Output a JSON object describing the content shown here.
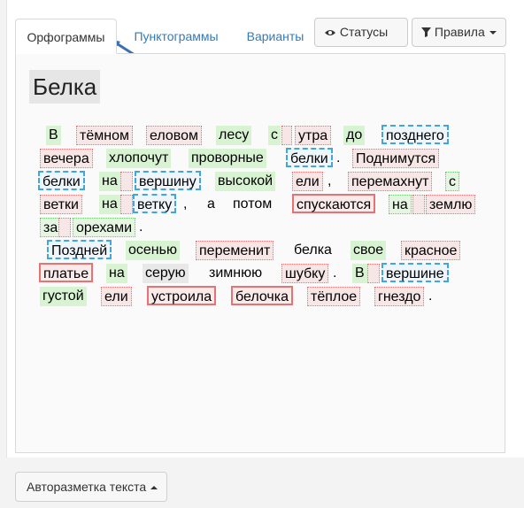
{
  "tabs": [
    {
      "label": "Орфограммы"
    },
    {
      "label": "Пунктограммы"
    },
    {
      "label": "Варианты"
    }
  ],
  "buttons": {
    "statuses": "Статусы",
    "rules": "Правила",
    "automark": "Авторазметка текста"
  },
  "icons": {
    "statuses": "eye-icon",
    "rules": "filter-icon",
    "caret": "caret-down-icon"
  },
  "title": "Белка",
  "colors": {
    "green": "#d8f3d2",
    "red": "#e57373",
    "blue": "#41a6e0",
    "link": "#337ab7"
  },
  "words": [
    "В",
    "тёмном",
    "еловом",
    "лесу",
    "с",
    "утра",
    "до",
    "позднего",
    "вечера",
    "хлопочут",
    "проворные",
    "белки",
    "Поднимутся",
    "белки",
    "на",
    "вершину",
    "высокой",
    "ели",
    "перемахнут",
    "с",
    "ветки",
    "на",
    "ветку",
    "а",
    "потом",
    "спускаются",
    "на",
    "землю",
    "за",
    "орехами",
    "Поздней",
    "осенью",
    "переменит",
    "белка",
    "свое",
    "красное",
    "платье",
    "на",
    "серую",
    "зимнюю",
    "шубку",
    "В",
    "вершине",
    "густой",
    "ели",
    "устроила",
    "белочка",
    "тёплое",
    "гнездо"
  ],
  "punct": [
    ".",
    ",",
    ",",
    ".",
    ".",
    ".",
    "."
  ]
}
